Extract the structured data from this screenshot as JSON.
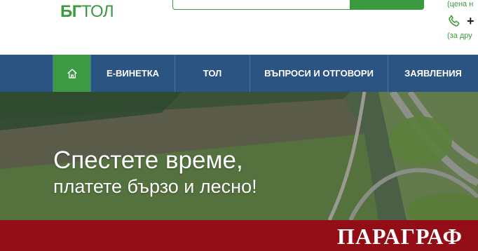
{
  "header": {
    "logo": {
      "part1": "БГ",
      "part2": "ТОЛ"
    },
    "hint_top": "(цена н",
    "phone": "+",
    "hint_bottom": "(за дру"
  },
  "nav": {
    "items": [
      {
        "label": "Е-ВИНЕТКА"
      },
      {
        "label": "ТОЛ"
      },
      {
        "label": "ВЪПРОСИ И ОТГОВОРИ"
      },
      {
        "label": "ЗАЯВЛЕНИЯ"
      }
    ]
  },
  "hero": {
    "line1": "Спестете време,",
    "line2": "платете бързо и лесно!"
  },
  "banner": {
    "text": "ПАРАГРАФ"
  },
  "colors": {
    "brand_green": "#3a9a3e",
    "nav_blue": "#2c5482",
    "home_green": "#3c9a45",
    "banner_red": "#930d16"
  },
  "icons": [
    "home-icon",
    "phone-icon"
  ]
}
